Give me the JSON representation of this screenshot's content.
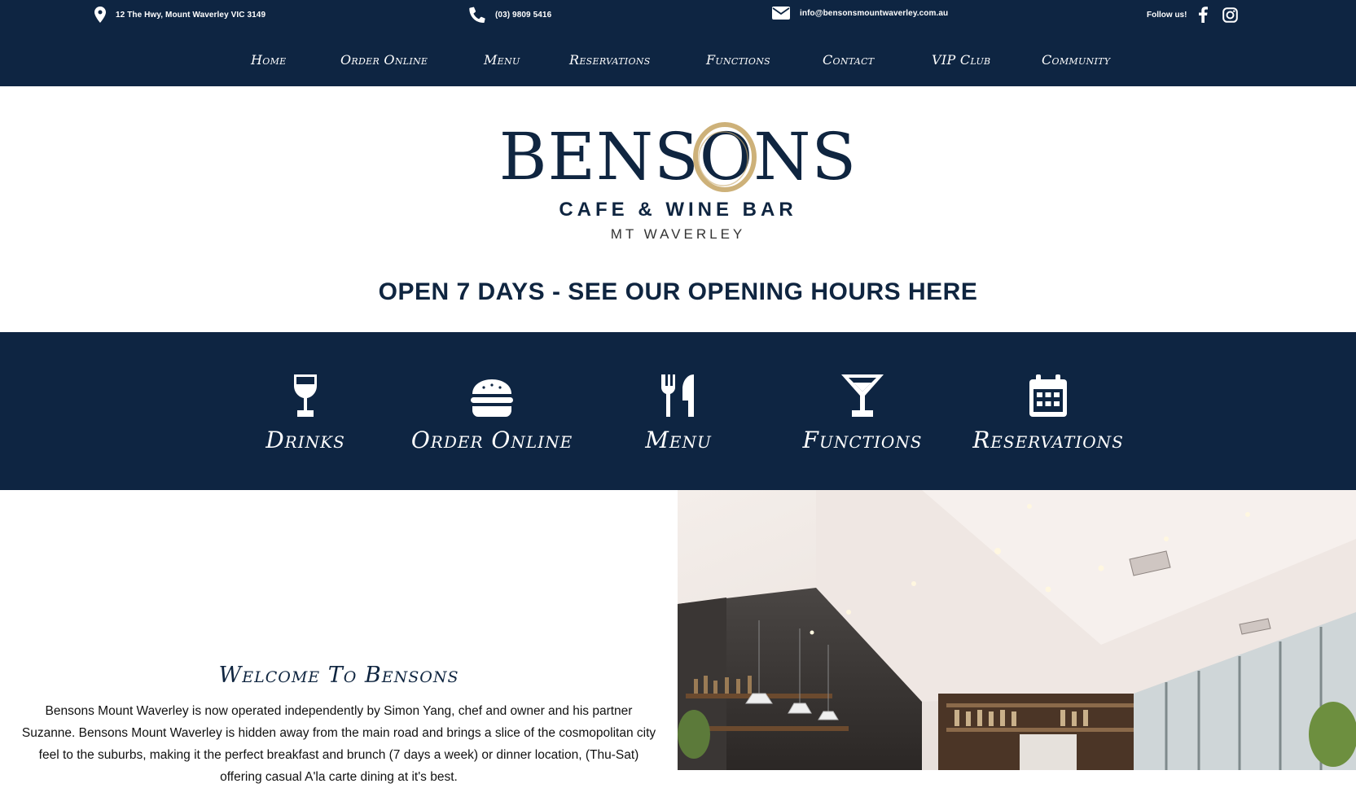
{
  "topbar": {
    "address": "12 The Hwy, Mount Waverley VIC 3149",
    "phone": "(03) 9809 5416",
    "email": "info@bensonsmountwaverley.com.au",
    "follow_label": "Follow us!",
    "social_icons": [
      "facebook-icon",
      "instagram-icon"
    ]
  },
  "nav": {
    "items": [
      "Home",
      "Order Online",
      "Menu",
      "Reservations",
      "Functions",
      "Contact",
      "VIP Club",
      "Community"
    ]
  },
  "logo": {
    "name": "BENSONS",
    "subtitle": "CAFE & WINE BAR",
    "location": "MT WAVERLEY"
  },
  "open_hours": "OPEN 7 DAYS - SEE OUR OPENING HOURS HERE",
  "features": [
    {
      "label": "Drinks",
      "icon": "wine-glass-icon"
    },
    {
      "label": "Order Online",
      "icon": "burger-icon"
    },
    {
      "label": "Menu",
      "icon": "utensils-icon"
    },
    {
      "label": "Functions",
      "icon": "cocktail-icon"
    },
    {
      "label": "Reservations",
      "icon": "calendar-icon"
    }
  ],
  "welcome": {
    "title": "Welcome To Bensons",
    "body": "Bensons Mount Waverley is now operated independently by Simon Yang, chef and owner and his partner Suzanne. Bensons Mount Waverley is hidden away from the main road and brings a slice of the cosmopolitan city feel to the suburbs, making it the perfect breakfast and brunch (7 days a week) or dinner location, (Thu-Sat) offering casual A'la carte dining at it's best."
  },
  "colors": {
    "navy": "#0e2542",
    "gold": "#c8a86a",
    "white": "#ffffff"
  }
}
